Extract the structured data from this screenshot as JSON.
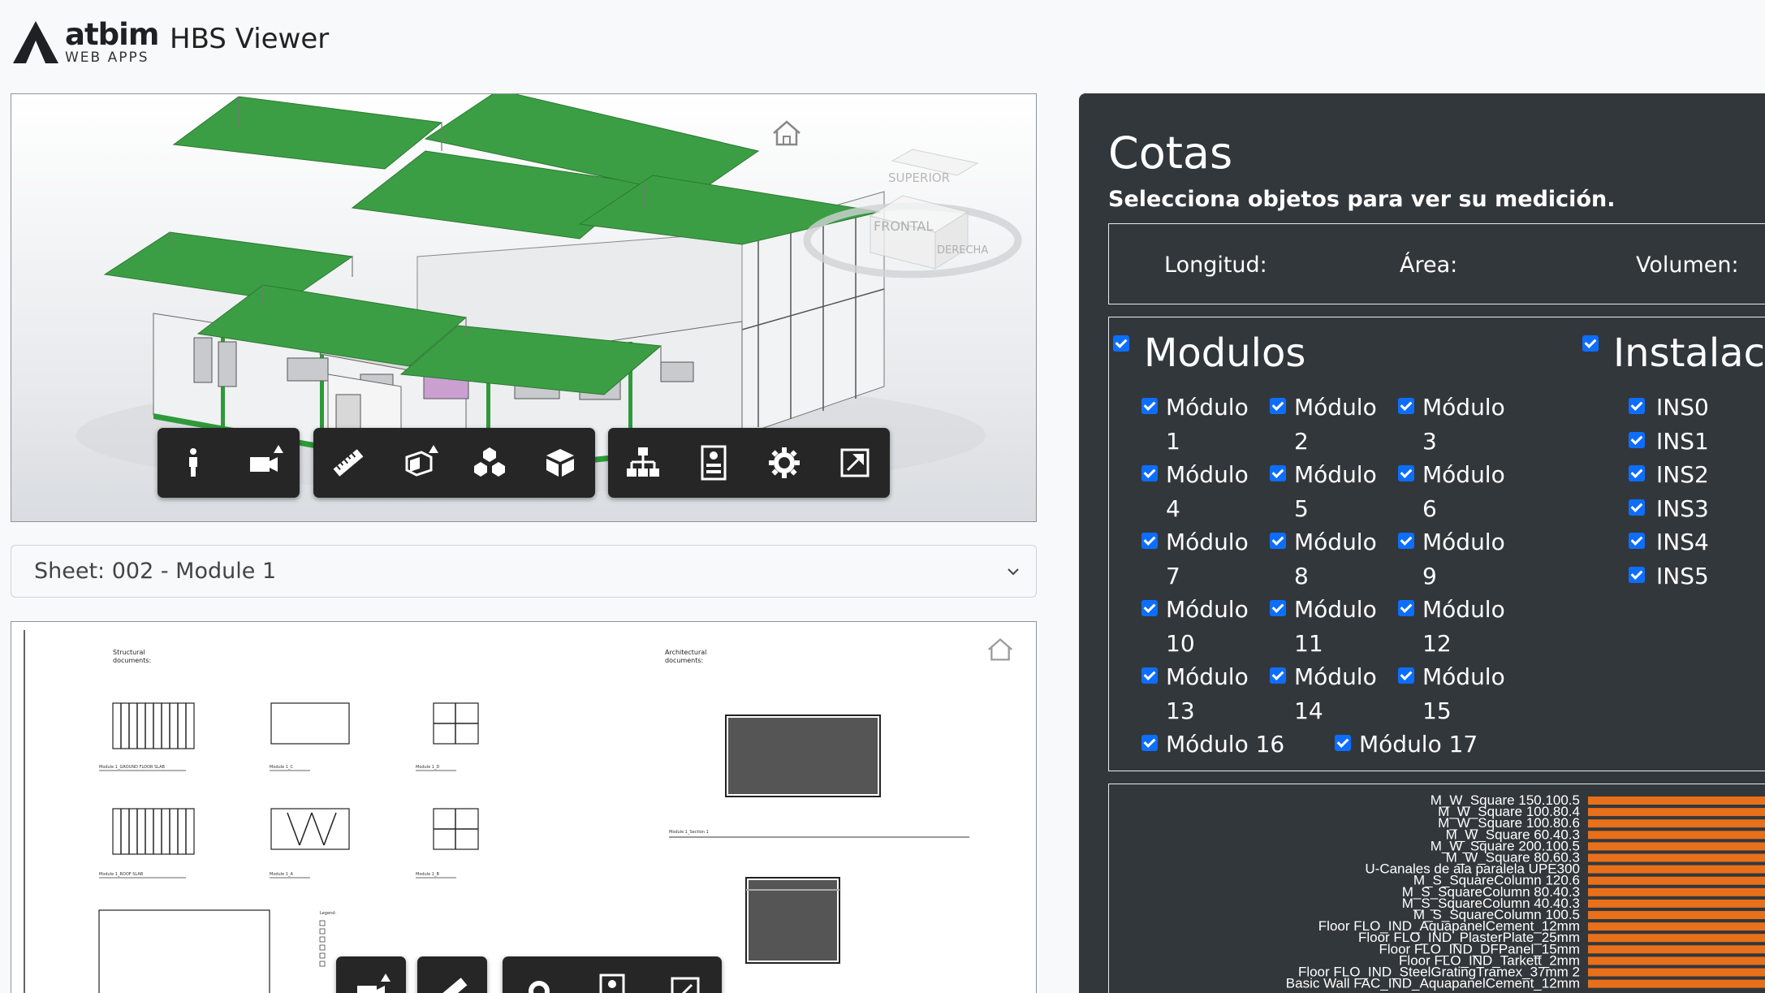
{
  "header": {
    "logo_word": "atbim",
    "logo_sub": "WEB APPS",
    "app_title": "HBS Viewer"
  },
  "viewer3d": {
    "viewcube": {
      "top": "SUPERIOR",
      "front": "FRONTAL",
      "right": "DERECHA"
    },
    "toolbar": [
      {
        "group": "navigation",
        "tools": [
          "walk-icon",
          "camera-icon"
        ]
      },
      {
        "group": "inspect",
        "tools": [
          "measure-icon",
          "section-icon",
          "explode-icon",
          "model-browser-icon"
        ]
      },
      {
        "group": "settings",
        "tools": [
          "structure-icon",
          "properties-icon",
          "gear-icon",
          "fullscreen-icon"
        ]
      }
    ]
  },
  "sheet_select": {
    "selected": "Sheet: 002 - Module 1"
  },
  "drawing": {
    "heading_left": "Structural\ndocuments:",
    "heading_right": "Architectural\ndocuments:",
    "heading_left_1": "Structural",
    "heading_left_2": "documents:",
    "heading_right_1": "Architectural",
    "heading_right_2": "documents:",
    "captions": [
      "Module 1_GROUND FLOOR SLAB",
      "Module 1_C",
      "Module 1_D",
      "Module 1_ROOF SLAB",
      "Module 1_A",
      "Module 1_B",
      "Module 1_Section 1"
    ],
    "legend_title": "Legend:"
  },
  "panel": {
    "title": "Cotas",
    "subtitle": "Selecciona objetos para ver su medición.",
    "measures": {
      "length_label": "Longitud:",
      "area_label": "Área:",
      "volume_label": "Volumen:"
    },
    "modulos": {
      "title": "Modulos",
      "items": [
        "Módulo 1",
        "Módulo 2",
        "Módulo 3",
        "Módulo 4",
        "Módulo 5",
        "Módulo 6",
        "Módulo 7",
        "Módulo 8",
        "Módulo 9",
        "Módulo 10",
        "Módulo 11",
        "Módulo 12",
        "Módulo 13",
        "Módulo 14",
        "Módulo 15",
        "Módulo 16",
        "Módulo 17"
      ]
    },
    "instalaciones": {
      "title": "Instalacio",
      "items": [
        "INS0",
        "INS1",
        "INS2",
        "INS3",
        "INS4",
        "INS5"
      ]
    },
    "accent": "#0d6efd"
  },
  "chart_data": {
    "type": "bar",
    "orientation": "horizontal",
    "categories": [
      "M_W_Square 150.100.5",
      "M_W_Square 100.80.4",
      "M_W_Square 100.80.6",
      "M_W_Square 60.40.3",
      "M_W_Square 200.100.5",
      "M_W_Square 80.60.3",
      "U-Canales de ala paralela UPE300",
      "M_S_SquareColumn 120.6",
      "M_S_SquareColumn 80.40.3",
      "M_S_SquareColumn 40.40.3",
      "M_S_SquareColumn 100.5",
      "Floor FLO_IND_AquapanelCement_12mm",
      "Floor FLO_IND_PlasterPlate_25mm",
      "Floor FLO_IND_DFPanel_15mm",
      "Floor FLO_IND_Tarkett_2mm",
      "Floor FLO_IND_SteelGratingTramex_37mm 2",
      "Basic Wall FAC_IND_AquapanelCement_12mm"
    ],
    "bar_color": "#e8701a"
  }
}
